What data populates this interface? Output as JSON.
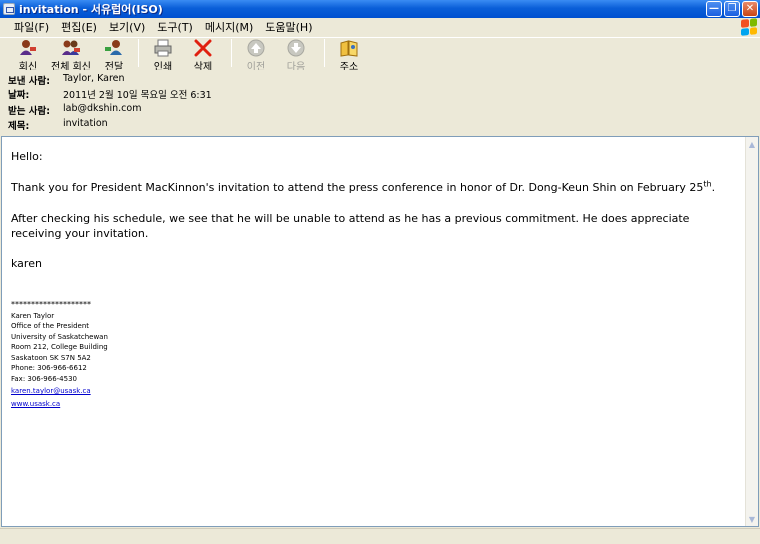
{
  "window": {
    "title": "invitation - 서유럽어(ISO)"
  },
  "menu": [
    "파일(F)",
    "편집(E)",
    "보기(V)",
    "도구(T)",
    "메시지(M)",
    "도움말(H)"
  ],
  "toolbar": {
    "reply": "회신",
    "reply_all": "전체 회신",
    "forward": "전달",
    "print": "인쇄",
    "delete": "삭제",
    "previous": "이전",
    "next": "다음",
    "addresses": "주소"
  },
  "headers": {
    "from_label": "보낸 사람:",
    "from": "Taylor, Karen",
    "date_label": "날짜:",
    "date": "2011년 2월 10일 목요일 오전 6:31",
    "to_label": "받는 사람:",
    "to": "lab@dkshin.com",
    "subject_label": "제목:",
    "subject": "invitation"
  },
  "message": {
    "greeting": "Hello:",
    "para1_before": "Thank you for President MacKinnon's invitation to attend the press conference in honor of Dr. Dong-Keun Shin on February 25",
    "para1_sup": "th",
    "para1_after": ".",
    "para2": "After checking his schedule, we see that he will be unable to attend as he has a previous commitment.  He does appreciate receiving your invitation.",
    "closing": "karen"
  },
  "signature": {
    "stars": "********************",
    "name": "Karen Taylor",
    "office": "Office of the President",
    "university": "University of Saskatchewan",
    "room": "Room 212, College Building",
    "city": "Saskatoon SK  S7N 5A2",
    "phone": "Phone:  306-966-6612",
    "fax": "Fax:  306-966-4530",
    "email": "karen.taylor@usask.ca",
    "web": "www.usask.ca"
  },
  "colors": {
    "titlebar": "#0a5fd8",
    "close_button": "#c84515",
    "link": "#0000cc"
  }
}
